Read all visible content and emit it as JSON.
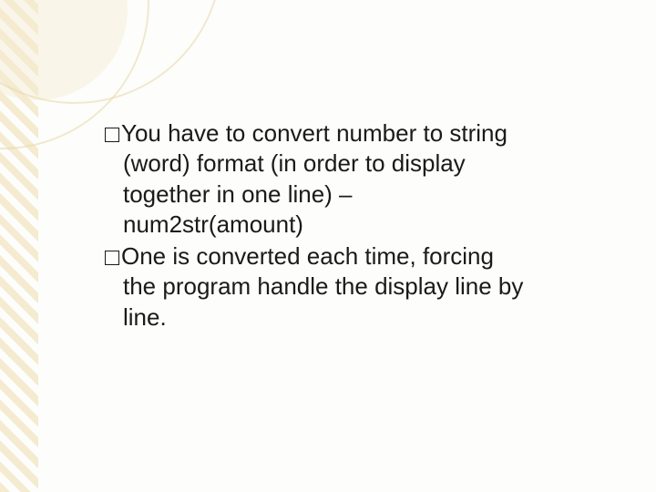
{
  "slide": {
    "bullets": [
      {
        "lines": [
          "You have to convert number to string",
          "(word) format (in order to display",
          "together in one line) –",
          "num2str(amount)"
        ]
      },
      {
        "lines": [
          "One is converted each time, forcing",
          "the program handle the display line by",
          "line."
        ]
      }
    ]
  }
}
